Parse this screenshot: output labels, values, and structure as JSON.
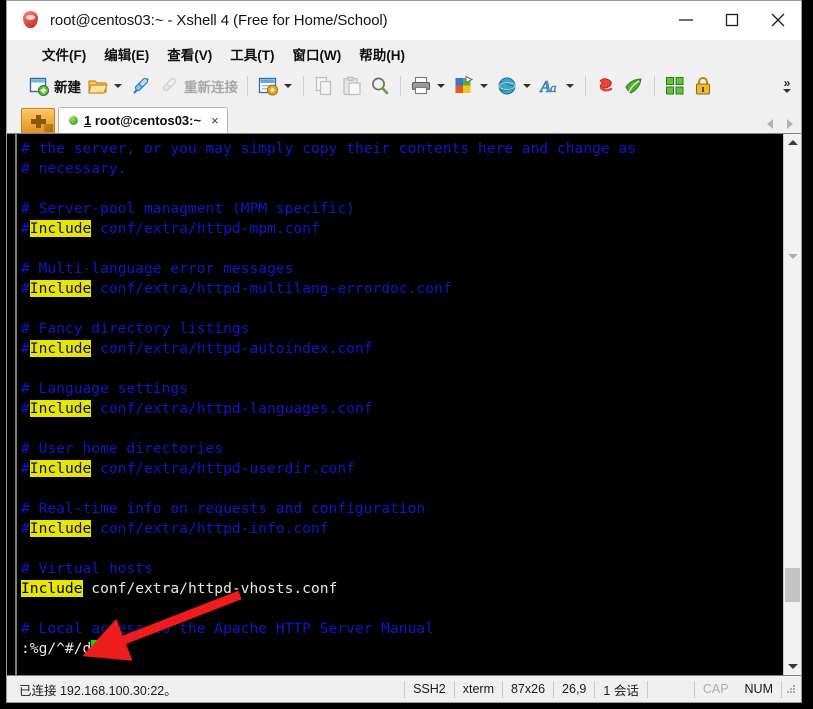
{
  "window": {
    "title": "root@centos03:~ - Xshell 4 (Free for Home/School)",
    "icon": "xshell-logo-icon",
    "minimize_label": "—",
    "maximize_label": "□",
    "close_label": "✕"
  },
  "menubar": {
    "items": [
      {
        "label": "文件(F)",
        "name": "menu-file"
      },
      {
        "label": "编辑(E)",
        "name": "menu-edit"
      },
      {
        "label": "查看(V)",
        "name": "menu-view"
      },
      {
        "label": "工具(T)",
        "name": "menu-tools"
      },
      {
        "label": "窗口(W)",
        "name": "menu-window"
      },
      {
        "label": "帮助(H)",
        "name": "menu-help"
      }
    ]
  },
  "toolbar": {
    "new_label": "新建",
    "reconnect_label": "重新连接",
    "overflow_label": "»",
    "buttons": [
      {
        "name": "new-session-button",
        "icon": "new-window-icon"
      },
      {
        "name": "open-session-button",
        "icon": "folder-open-icon"
      },
      {
        "name": "connect-button",
        "icon": "link-connect-icon"
      },
      {
        "name": "reconnect-button",
        "icon": "link-broken-icon"
      },
      {
        "name": "properties-button",
        "icon": "session-properties-icon"
      },
      {
        "name": "copy-button",
        "icon": "copy-icon"
      },
      {
        "name": "paste-button",
        "icon": "paste-icon"
      },
      {
        "name": "find-button",
        "icon": "search-icon"
      },
      {
        "name": "print-button",
        "icon": "printer-icon"
      },
      {
        "name": "color-scheme-button",
        "icon": "color-palette-icon"
      },
      {
        "name": "globe-button",
        "icon": "globe-icon"
      },
      {
        "name": "font-button",
        "icon": "font-letter-icon"
      },
      {
        "name": "xshell-button",
        "icon": "xshell-red-icon"
      },
      {
        "name": "xftp-button",
        "icon": "xftp-green-icon"
      },
      {
        "name": "arrange-button",
        "icon": "tile-windows-icon"
      },
      {
        "name": "lock-button",
        "icon": "padlock-icon"
      }
    ]
  },
  "tabbar": {
    "new_tab_name": "new-tab-button",
    "tab": {
      "number": "1",
      "label": " root@centos03:~",
      "close_label": "×",
      "status": "connected"
    }
  },
  "terminal": {
    "lines": [
      {
        "segments": [
          {
            "text": "# the server, or you may simply copy their contents here and change as",
            "style": "cmt"
          }
        ]
      },
      {
        "segments": [
          {
            "text": "# necessary.",
            "style": "cmt"
          }
        ]
      },
      {
        "segments": [
          {
            "text": "",
            "style": "cmt"
          }
        ]
      },
      {
        "segments": [
          {
            "text": "# Server-pool managment (MPM specific)",
            "style": "cmt"
          }
        ]
      },
      {
        "segments": [
          {
            "text": "#",
            "style": "cmt"
          },
          {
            "text": "Include",
            "style": "hl"
          },
          {
            "text": " conf/extra/httpd-mpm.conf",
            "style": "cmt"
          }
        ]
      },
      {
        "segments": [
          {
            "text": "",
            "style": "cmt"
          }
        ]
      },
      {
        "segments": [
          {
            "text": "# Multi-language error messages",
            "style": "cmt"
          }
        ]
      },
      {
        "segments": [
          {
            "text": "#",
            "style": "cmt"
          },
          {
            "text": "Include",
            "style": "hl"
          },
          {
            "text": " conf/extra/httpd-multilang-errordoc.conf",
            "style": "cmt"
          }
        ]
      },
      {
        "segments": [
          {
            "text": "",
            "style": "cmt"
          }
        ]
      },
      {
        "segments": [
          {
            "text": "# Fancy directory listings",
            "style": "cmt"
          }
        ]
      },
      {
        "segments": [
          {
            "text": "#",
            "style": "cmt"
          },
          {
            "text": "Include",
            "style": "hl"
          },
          {
            "text": " conf/extra/httpd-autoindex.conf",
            "style": "cmt"
          }
        ]
      },
      {
        "segments": [
          {
            "text": "",
            "style": "cmt"
          }
        ]
      },
      {
        "segments": [
          {
            "text": "# Language settings",
            "style": "cmt"
          }
        ]
      },
      {
        "segments": [
          {
            "text": "#",
            "style": "cmt"
          },
          {
            "text": "Include",
            "style": "hl"
          },
          {
            "text": " conf/extra/httpd-languages.conf",
            "style": "cmt"
          }
        ]
      },
      {
        "segments": [
          {
            "text": "",
            "style": "cmt"
          }
        ]
      },
      {
        "segments": [
          {
            "text": "# User home directories",
            "style": "cmt"
          }
        ]
      },
      {
        "segments": [
          {
            "text": "#",
            "style": "cmt"
          },
          {
            "text": "Include",
            "style": "hl"
          },
          {
            "text": " conf/extra/httpd-userdir.conf",
            "style": "cmt"
          }
        ]
      },
      {
        "segments": [
          {
            "text": "",
            "style": "cmt"
          }
        ]
      },
      {
        "segments": [
          {
            "text": "# Real-time info on requests and configuration",
            "style": "cmt"
          }
        ]
      },
      {
        "segments": [
          {
            "text": "#",
            "style": "cmt"
          },
          {
            "text": "Include",
            "style": "hl"
          },
          {
            "text": " conf/extra/httpd-info.conf",
            "style": "cmt"
          }
        ]
      },
      {
        "segments": [
          {
            "text": "",
            "style": "cmt"
          }
        ]
      },
      {
        "segments": [
          {
            "text": "# Virtual hosts",
            "style": "cmt"
          }
        ]
      },
      {
        "segments": [
          {
            "text": "Include",
            "style": "hl-w"
          },
          {
            "text": " conf/extra/httpd-vhosts.conf",
            "style": "white"
          }
        ]
      },
      {
        "segments": [
          {
            "text": "",
            "style": "cmt"
          }
        ]
      },
      {
        "segments": [
          {
            "text": "# Local access to the Apache HTTP Server Manual",
            "style": "cmt"
          }
        ]
      }
    ],
    "command_line": ":%g/^#/d",
    "cursor": "block-cursor"
  },
  "statusbar": {
    "connection": "已连接 192.168.100.30:22。",
    "protocol": "SSH2",
    "term_type": "xterm",
    "size": "87x26",
    "cursor_pos": "26,9",
    "sessions": "1 会话",
    "caps": "CAP",
    "num": "NUM"
  },
  "annotation": {
    "arrow": "red-arrow-pointing-to-cursor",
    "color": "#ee1d1d"
  }
}
